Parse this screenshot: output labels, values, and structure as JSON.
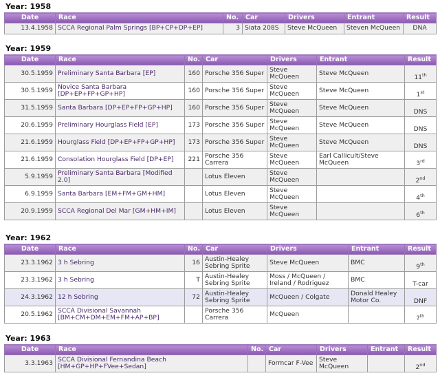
{
  "headers": {
    "date": "Date",
    "race": "Race",
    "no": "No.",
    "car": "Car",
    "drivers": "Drivers",
    "entrant": "Entrant",
    "result": "Result"
  },
  "sections": [
    {
      "year": "Year: 1958",
      "rows": [
        {
          "date": "13.4.1958",
          "race": "SCCA Regional Palm Springs [BP+CP+DP+EP]",
          "no": "3",
          "car": "Siata 208S",
          "drivers": "Steve McQueen",
          "entrant": "Steven McQueen",
          "result": "DNA",
          "sup": ""
        }
      ]
    },
    {
      "year": "Year: 1959",
      "rows": [
        {
          "date": "30.5.1959",
          "race": "Preliminary Santa Barbara [EP]",
          "no": "160",
          "car": "Porsche 356 Super",
          "drivers": "Steve McQueen",
          "entrant": "Steve McQueen",
          "result": "11",
          "sup": "th"
        },
        {
          "date": "30.5.1959",
          "race": "Novice Santa Barbara [DP+EP+FP+GP+HP]",
          "no": "160",
          "car": "Porsche 356 Super",
          "drivers": "Steve McQueen",
          "entrant": "Steve McQueen",
          "result": "1",
          "sup": "st"
        },
        {
          "date": "31.5.1959",
          "race": "Santa Barbara [DP+EP+FP+GP+HP]",
          "no": "160",
          "car": "Porsche 356 Super",
          "drivers": "Steve McQueen",
          "entrant": "Steve McQueen",
          "result": "DNS",
          "sup": ""
        },
        {
          "date": "20.6.1959",
          "race": "Preliminary Hourglass Field [EP]",
          "no": "173",
          "car": "Porsche 356 Super",
          "drivers": "Steve McQueen",
          "entrant": "Steve McQueen",
          "result": "DNS",
          "sup": ""
        },
        {
          "date": "21.6.1959",
          "race": "Hourglass Field [DP+EP+FP+GP+HP]",
          "no": "173",
          "car": "Porsche 356 Super",
          "drivers": "Steve McQueen",
          "entrant": "Steve McQueen",
          "result": "DNS",
          "sup": ""
        },
        {
          "date": "21.6.1959",
          "race": "Consolation Hourglass Field [DP+EP]",
          "no": "221",
          "car": "Porsche 356 Carrera",
          "drivers": "Steve McQueen",
          "entrant": "Earl Callicult/Steve McQueen",
          "result": "3",
          "sup": "rd"
        },
        {
          "date": "5.9.1959",
          "race": "Preliminary Santa Barbara [Modified 2.0]",
          "no": "",
          "car": "Lotus Eleven",
          "drivers": "Steve McQueen",
          "entrant": "",
          "result": "2",
          "sup": "nd"
        },
        {
          "date": "6.9.1959",
          "race": "Santa Barbara [EM+FM+GM+HM]",
          "no": "",
          "car": "Lotus Eleven",
          "drivers": "Steve McQueen",
          "entrant": "",
          "result": "4",
          "sup": "th"
        },
        {
          "date": "20.9.1959",
          "race": "SCCA Regional Del Mar [GM+HM+IM]",
          "no": "",
          "car": "Lotus Eleven",
          "drivers": "Steve McQueen",
          "entrant": "",
          "result": "6",
          "sup": "th"
        }
      ]
    },
    {
      "year": "Year: 1962",
      "rows": [
        {
          "date": "23.3.1962",
          "race": "3 h Sebring",
          "no": "16",
          "car": "Austin-Healey Sebring Sprite",
          "drivers": "Steve McQueen",
          "entrant": "BMC",
          "result": "9",
          "sup": "th"
        },
        {
          "date": "23.3.1962",
          "race": "3 h Sebring",
          "no": "T",
          "car": "Austin-Healey Sebring Sprite",
          "drivers": "Moss / McQueen / Ireland / Rodriguez",
          "entrant": "BMC",
          "result": "T-car",
          "sup": ""
        },
        {
          "date": "24.3.1962",
          "race": "12 h Sebring",
          "no": "72",
          "car": "Austin-Healey Sebring Sprite",
          "drivers": "McQueen / Colgate",
          "entrant": "Donald Healey Motor Co.",
          "result": "DNF",
          "sup": ""
        },
        {
          "date": "20.5.1962",
          "race": "SCCA Divisional Savannah [BM+CM+DM+EM+FM+AP+BP]",
          "no": "",
          "car": "Porsche 356 Carrera",
          "drivers": "McQueen",
          "entrant": "",
          "result": "?",
          "sup": "th"
        }
      ]
    },
    {
      "year": "Year: 1963",
      "rows": [
        {
          "date": "3.3.1963",
          "race": "SCCA Divisional Fernandina Beach [HM+GP+HP+FVee+Sedan]",
          "no": "",
          "car": "Formcar F-Vee",
          "drivers": "Steve McQueen",
          "entrant": "",
          "result": "2",
          "sup": "nd"
        }
      ]
    }
  ]
}
